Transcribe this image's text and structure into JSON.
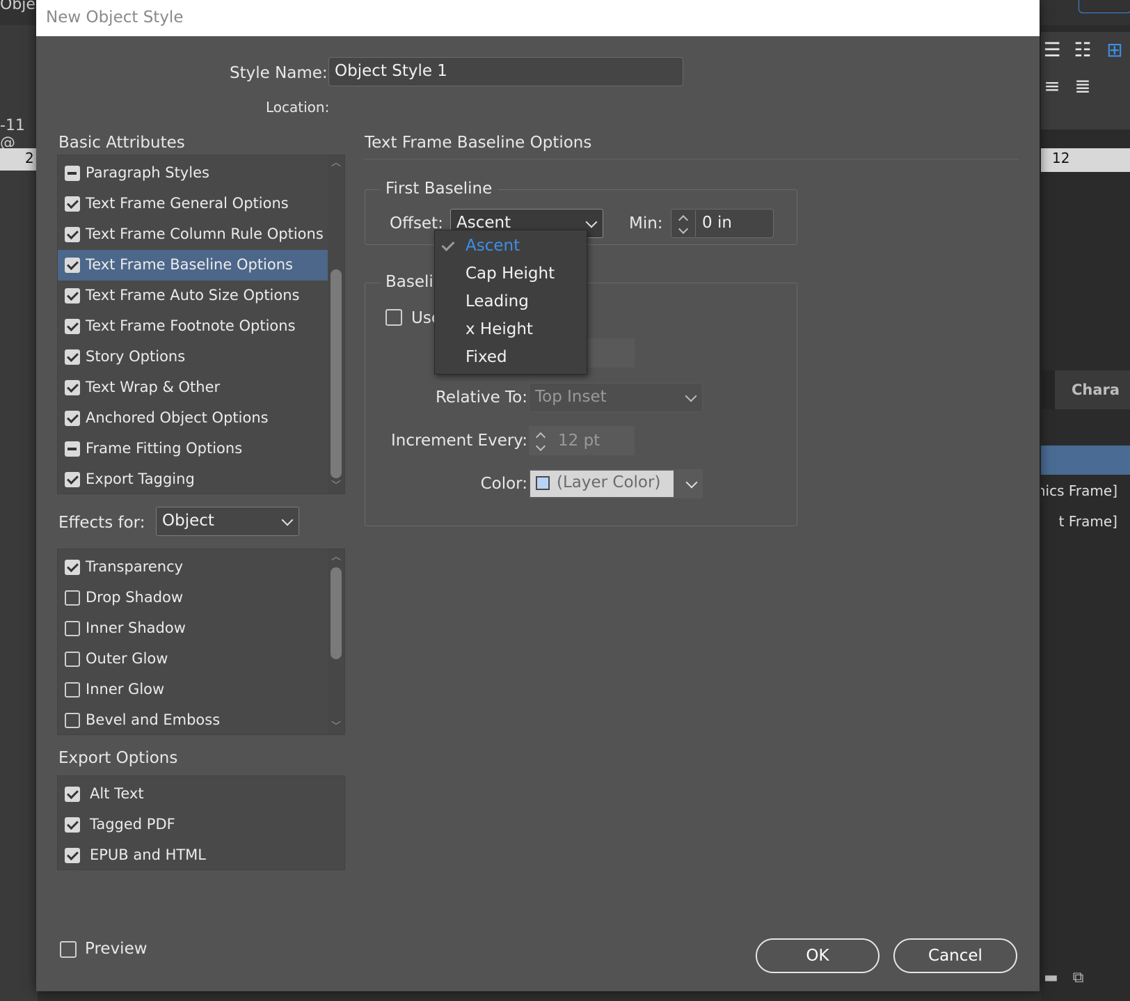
{
  "background": {
    "left_tab_title": "Objec",
    "zoom_fragment": "-11 @",
    "ruler_left_number": "2",
    "ruler_right_number": "12",
    "panel_tab_label": "Chara",
    "panel_rows": [
      "phics Frame]",
      "t Frame]"
    ]
  },
  "dialog": {
    "title": "New Object Style",
    "style_name_label": "Style Name:",
    "style_name_value": "Object Style 1",
    "location_label": "Location:",
    "basic_attributes": {
      "title": "Basic Attributes",
      "items": [
        {
          "label": "Paragraph Styles",
          "state": "mixed"
        },
        {
          "label": "Text Frame General Options",
          "state": "checked"
        },
        {
          "label": "Text Frame Column Rule Options",
          "state": "checked"
        },
        {
          "label": "Text Frame Baseline Options",
          "state": "checked",
          "selected": true
        },
        {
          "label": "Text Frame Auto Size Options",
          "state": "checked"
        },
        {
          "label": "Text Frame Footnote Options",
          "state": "checked"
        },
        {
          "label": "Story Options",
          "state": "checked"
        },
        {
          "label": "Text Wrap & Other",
          "state": "checked"
        },
        {
          "label": "Anchored Object Options",
          "state": "checked"
        },
        {
          "label": "Frame Fitting Options",
          "state": "mixed"
        },
        {
          "label": "Export Tagging",
          "state": "checked"
        }
      ]
    },
    "effects": {
      "label": "Effects for:",
      "target_value": "Object",
      "items": [
        {
          "label": "Transparency",
          "state": "checked"
        },
        {
          "label": "Drop Shadow",
          "state": "empty"
        },
        {
          "label": "Inner Shadow",
          "state": "empty"
        },
        {
          "label": "Outer Glow",
          "state": "empty"
        },
        {
          "label": "Inner Glow",
          "state": "empty"
        },
        {
          "label": "Bevel and Emboss",
          "state": "empty"
        }
      ]
    },
    "export_options": {
      "title": "Export Options",
      "items": [
        {
          "label": "Alt Text",
          "state": "checked"
        },
        {
          "label": "Tagged PDF",
          "state": "checked"
        },
        {
          "label": "EPUB and HTML",
          "state": "checked"
        }
      ]
    },
    "preview_label": "Preview",
    "panel": {
      "title": "Text Frame Baseline Options",
      "first_baseline": {
        "group_title": "First Baseline",
        "offset_label": "Offset:",
        "offset_value": "Ascent",
        "min_label": "Min:",
        "min_value": "0 in"
      },
      "baseline_grid": {
        "group_title": "Baseline",
        "use_custom_label": "Use C",
        "relative_to_label": "Relative To:",
        "relative_to_value": "Top Inset",
        "increment_label": "Increment Every:",
        "increment_value": "12 pt",
        "color_label": "Color:",
        "color_value": "(Layer Color)",
        "swatch_color": "#b8d3f7"
      },
      "offset_dropdown": {
        "options": [
          "Ascent",
          "Cap Height",
          "Leading",
          "x Height",
          "Fixed"
        ],
        "selected_index": 0,
        "selected_color": "#3f8fe6"
      }
    },
    "buttons": {
      "ok": "OK",
      "cancel": "Cancel"
    }
  }
}
